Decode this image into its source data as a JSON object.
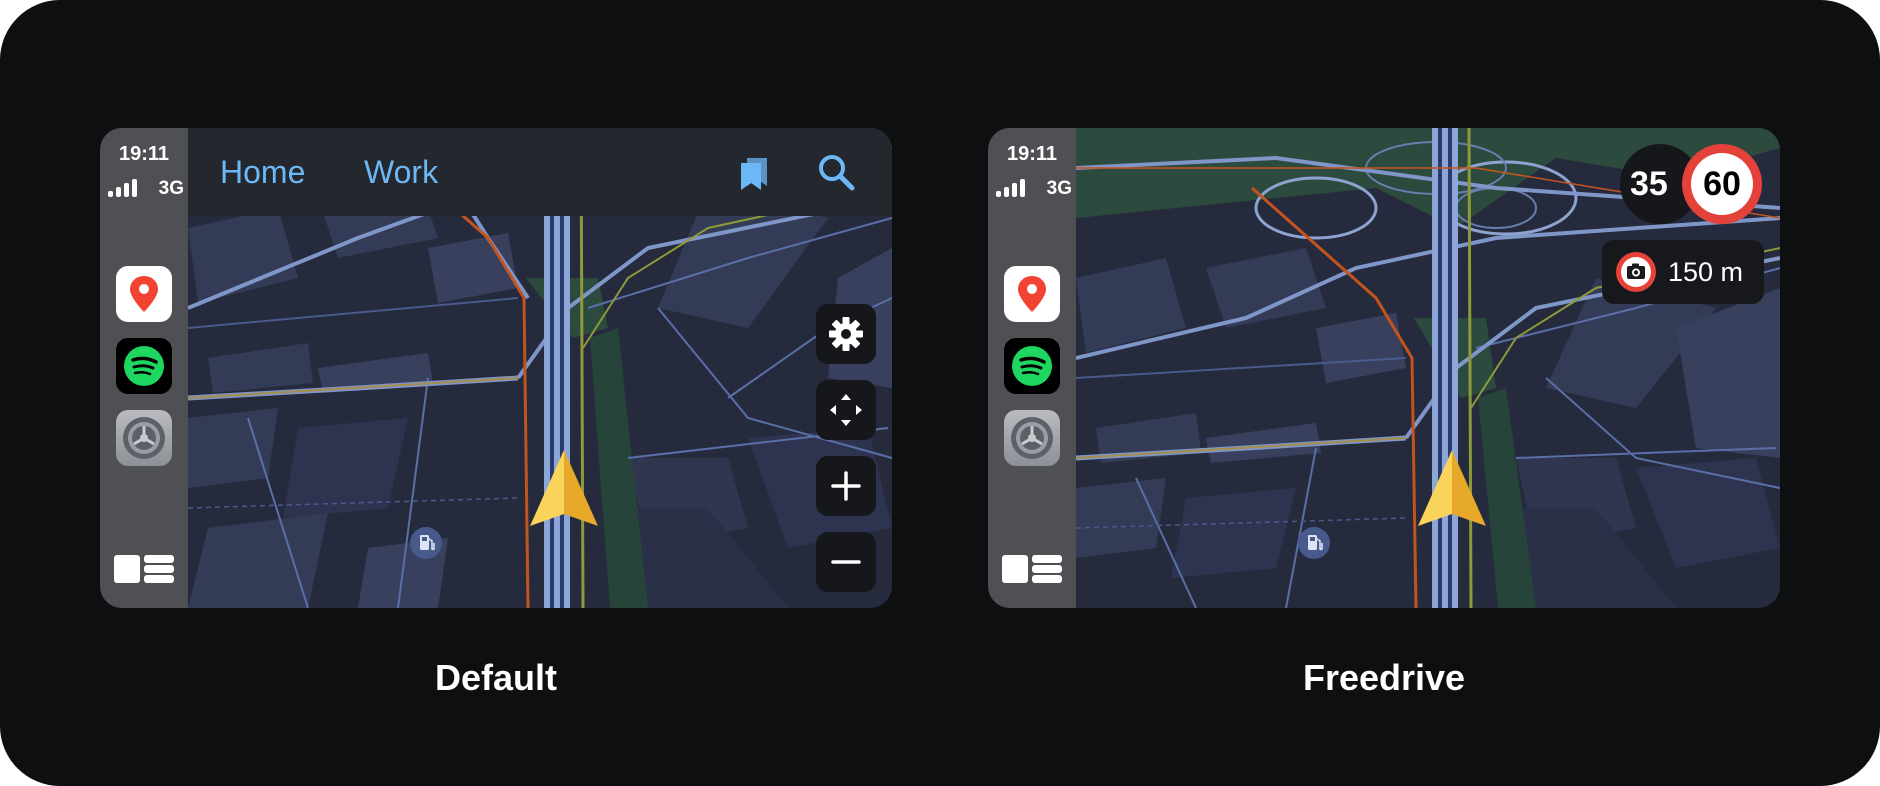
{
  "default_screen": {
    "status": {
      "time": "19:11",
      "network": "3G"
    },
    "topbar": {
      "home_label": "Home",
      "work_label": "Work"
    },
    "caption": "Default"
  },
  "freedrive_screen": {
    "status": {
      "time": "19:11",
      "network": "3G"
    },
    "current_speed": "35",
    "speed_limit": "60",
    "camera_distance": "150 m",
    "caption": "Freedrive"
  },
  "dock_apps": [
    "maps-icon",
    "spotify-icon",
    "settings-icon"
  ],
  "icons": {
    "topbar": [
      "bookmarks-icon",
      "search-icon"
    ],
    "map_controls": [
      "gear-icon",
      "pan-arrows-icon",
      "plus-icon",
      "minus-icon"
    ],
    "poi": "fuel-station-icon",
    "location": "navigation-arrow-icon",
    "camera": "speed-camera-icon"
  },
  "colors": {
    "background": "#0e0f11",
    "dock": "#4f5054",
    "map": "#252a3c",
    "link": "#6cb8f7",
    "speed_limit_ring": "#e4413a",
    "arrow": "#f5c33b"
  }
}
